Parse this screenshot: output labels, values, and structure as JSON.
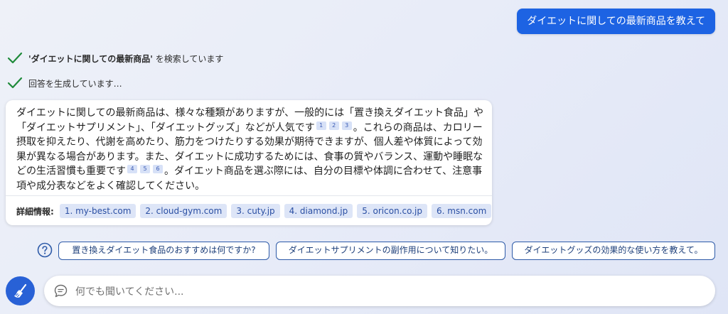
{
  "user_message": "ダイエットに関しての最新商品を教えて",
  "status": [
    {
      "icon": "checkmark-icon",
      "bold_prefix": "'ダイエットに関しての最新商品'",
      "text_suffix": " を検索しています"
    },
    {
      "icon": "checkmark-icon",
      "text": "回答を生成しています…"
    }
  ],
  "answer": {
    "segments": [
      "ダイエットに関しての最新商品は、様々な種類がありますが、一般的には「置き換えダイエット食品」や「ダイエットサプリメント」、「ダイエットグッズ」などが人気です",
      "。これらの商品は、カロリー摂取を抑えたり、代謝を高めたり、筋力をつけたりする効果が期待できますが、個人差や体質によって効果が異なる場合があります。また、ダイエットに成功するためには、食事の質やバランス、運動や睡眠などの生活習慣も重要です",
      "。ダイエット商品を選ぶ際には、自分の目標や体調に合わせて、注意事項や成分表などをよく確認してください。"
    ],
    "citations_group1": [
      "1",
      "2",
      "3"
    ],
    "citations_group2": [
      "4",
      "5",
      "6"
    ]
  },
  "sources": {
    "label": "詳細情報:",
    "items": [
      "1. my-best.com",
      "2. cloud-gym.com",
      "3. cuty.jp",
      "4. diamond.jp",
      "5. oricon.co.jp",
      "6. msn.com"
    ]
  },
  "suggestions": [
    "置き換えダイエット食品のおすすめは何ですか?",
    "ダイエットサプリメントの副作用について知りたい。",
    "ダイエットグッズの効果的な使い方を教えて。"
  ],
  "input": {
    "placeholder": "何でも聞いてください..."
  },
  "icons": {
    "help": "question-circle-icon",
    "new_topic": "broom-icon",
    "chat": "chat-bubble-icon"
  },
  "colors": {
    "accent": "#1d63e3",
    "check": "#1f8a3a",
    "chip_bg": "#dde5f7",
    "chip_text": "#2a4fa3"
  }
}
